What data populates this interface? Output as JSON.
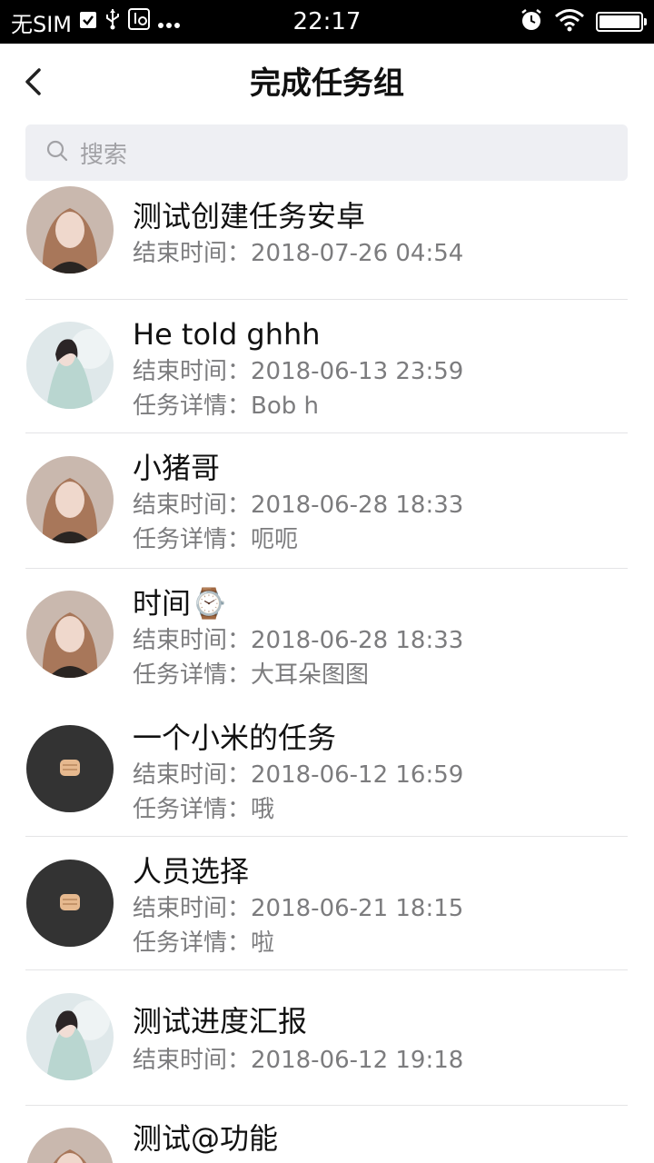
{
  "status_bar": {
    "carrier": "无SIM",
    "time": "22:17",
    "icons_left": [
      "checkbox-icon",
      "usb-icon",
      "usb-settings-icon",
      "more-dots-icon"
    ],
    "icons_right": [
      "alarm-icon",
      "wifi-icon",
      "battery-icon"
    ]
  },
  "nav": {
    "title": "完成任务组",
    "back_icon": "chevron-left-icon"
  },
  "search": {
    "placeholder": "搜索"
  },
  "labels": {
    "end_time": "结束时间：",
    "detail": "任务详情："
  },
  "tasks": [
    {
      "title": "测试创建任务安卓",
      "end_time": "2018-07-26 04:54",
      "detail": null,
      "avatar": "blonde-woman-photo"
    },
    {
      "title": "He told ghhh",
      "end_time": "2018-06-13 23:59",
      "detail": "Bob h",
      "avatar": "woman-light-dress-photo"
    },
    {
      "title": "小猪哥",
      "end_time": "2018-06-28 18:33",
      "detail": "呃呃",
      "avatar": "blonde-woman-photo"
    },
    {
      "title": "时间⌚",
      "end_time": "2018-06-28 18:33",
      "detail": "大耳朵图图",
      "avatar": "blonde-woman-photo"
    },
    {
      "title": "一个小米的任务",
      "end_time": "2018-06-12 16:59",
      "detail": "哦",
      "avatar": "fist-emoji-dark"
    },
    {
      "title": "人员选择",
      "end_time": "2018-06-21 18:15",
      "detail": "啦",
      "avatar": "fist-emoji-dark"
    },
    {
      "title": "测试进度汇报",
      "end_time": "2018-06-12 19:18",
      "detail": null,
      "avatar": "woman-light-dress-photo"
    },
    {
      "title": "测试@功能",
      "end_time": null,
      "detail": null,
      "avatar": "blonde-woman-photo"
    }
  ]
}
